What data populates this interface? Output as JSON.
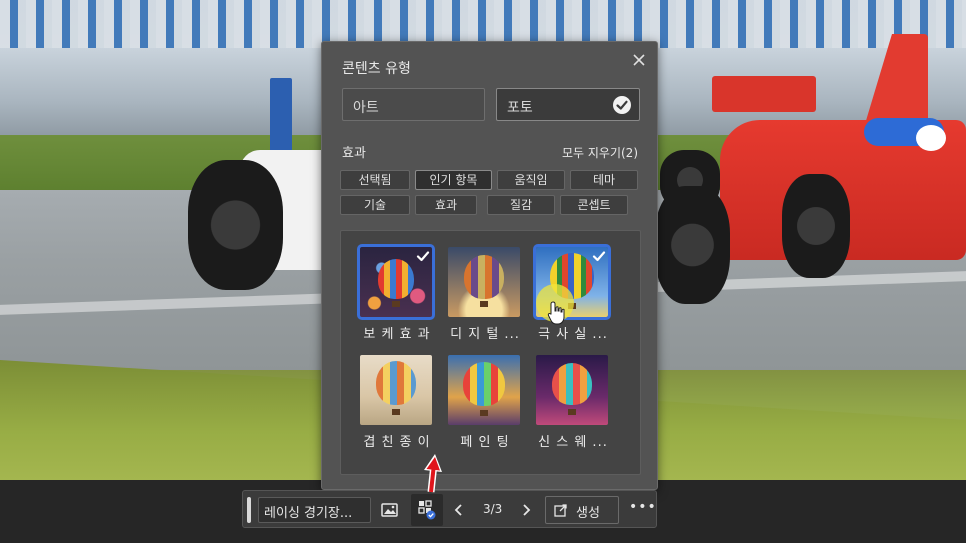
{
  "dialog": {
    "title": "콘텐츠 유형",
    "content_types": [
      {
        "label": "아트",
        "selected": false
      },
      {
        "label": "포토",
        "selected": true
      }
    ],
    "effects_label": "효과",
    "clear_all": "모두 지우기(2)",
    "filter_chips": [
      {
        "label": "선택됨",
        "selected": false
      },
      {
        "label": "인기 항목",
        "selected": true
      },
      {
        "label": "움직임",
        "selected": false
      },
      {
        "label": "테마",
        "selected": false
      },
      {
        "label": "기술",
        "selected": false
      },
      {
        "label": "효과",
        "selected": false
      },
      {
        "label": "질감",
        "selected": false
      },
      {
        "label": "콘셉트",
        "selected": false
      }
    ],
    "effects": [
      {
        "label": "보 케 효 과",
        "selected": true,
        "icon": "bokeh-balloon"
      },
      {
        "label": "디 지 털 ...",
        "selected": false,
        "icon": "digital-balloon"
      },
      {
        "label": "극 사 실 ...",
        "selected": true,
        "icon": "hyperreal-balloon"
      },
      {
        "label": "겹 친 종 이",
        "selected": false,
        "icon": "layered-paper-balloon"
      },
      {
        "label": "페 인 팅",
        "selected": false,
        "icon": "painting-balloon"
      },
      {
        "label": "신 스 웨 ...",
        "selected": false,
        "icon": "synthwave-balloon"
      }
    ]
  },
  "toolbar": {
    "prompt": "레이싱 경기장...",
    "page": "3/3",
    "generate_label": "생성",
    "more": "•••"
  },
  "colors": {
    "accent": "#3a6fd8",
    "panel": "#535353",
    "annotation_arrow": "#e0151c"
  }
}
